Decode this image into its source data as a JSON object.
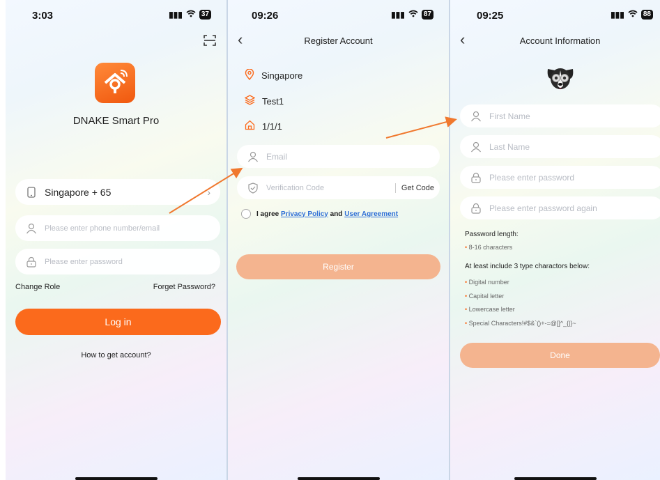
{
  "screen1": {
    "status_time": "3:03",
    "battery": "37",
    "app_name": "DNAKE Smart Pro",
    "country": "Singapore + 65",
    "phone_placeholder": "Please enter phone number/email",
    "password_placeholder": "Please enter password",
    "change_role": "Change Role",
    "forget_password": "Forget Password?",
    "login_label": "Log in",
    "how_to_get": "How to get account?",
    "scan_icon": "scan-icon",
    "logo_color": "#f26a1b"
  },
  "screen2": {
    "status_time": "09:26",
    "battery": "87",
    "title": "Register Account",
    "location": "Singapore",
    "project": "Test1",
    "unit": "1/1/1",
    "email_placeholder": "Email",
    "code_placeholder": "Verification Code",
    "get_code": "Get Code",
    "agree_prefix": "I agree",
    "privacy": "Privacy Policy",
    "and": "and",
    "user_agreement": "User Agreement",
    "register_label": "Register"
  },
  "screen3": {
    "status_time": "09:25",
    "battery": "88",
    "title": "Account Information",
    "first_name_placeholder": "First Name",
    "last_name_placeholder": "Last Name",
    "password_placeholder": "Please enter password",
    "password_again_placeholder": "Please enter password again",
    "pw_length_title": "Password length:",
    "pw_length_rule": "8-16 characters",
    "pw_type_title": "At least include 3 type charactors below:",
    "rules": [
      "Digital number",
      "Capital letter",
      "Lowercase letter",
      "Special Characters!#$&`()+-=@[]^_{|}~"
    ],
    "done_label": "Done"
  },
  "colors": {
    "accent": "#fb6a1c",
    "accent_disabled": "#f4b48f",
    "link": "#2f6fd6"
  }
}
